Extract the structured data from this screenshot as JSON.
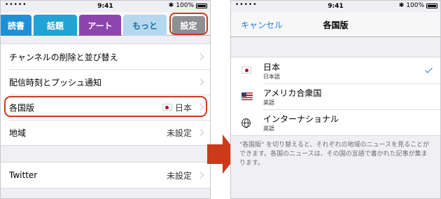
{
  "left": {
    "status": {
      "carrier": "•••••",
      "time": "9:41",
      "battery": "100%"
    },
    "tabs": [
      "読書",
      "話題",
      "アート",
      "もっと",
      "設定"
    ],
    "rows_1": [
      {
        "label": "チャンネルの削除と並び替え",
        "value": ""
      },
      {
        "label": "配信時刻とプッシュ通知",
        "value": ""
      },
      {
        "label": "各国版",
        "value": "日本"
      },
      {
        "label": "地域",
        "value": "未設定"
      }
    ],
    "rows_2": [
      {
        "label": "Twitter",
        "value": "未設定"
      }
    ],
    "colors": {
      "highlight": "#cc3a1a",
      "tab_settings": "#8e8e93",
      "tab_art": "#8e44ad"
    }
  },
  "right": {
    "status": {
      "carrier": "•••••",
      "time": "9:41",
      "battery": "100%"
    },
    "nav": {
      "cancel": "キャンセル",
      "title": "各国版"
    },
    "editions": [
      {
        "name": "日本",
        "language": "日本語",
        "icon": "japan-flag-icon",
        "selected": true
      },
      {
        "name": "アメリカ合衆国",
        "language": "英語",
        "icon": "usa-flag-icon",
        "selected": false
      },
      {
        "name": "インターナショナル",
        "language": "英語",
        "icon": "globe-icon",
        "selected": false
      }
    ],
    "footnote": "\"各国版\" を切り替えると、それぞれの地域のニュースを見ることができます。各国のニュースは、その国の言語で書かれた記事が集まります。",
    "colors": {
      "accent": "#1b7fe4"
    }
  },
  "arrow_color": "#cc3a1a"
}
